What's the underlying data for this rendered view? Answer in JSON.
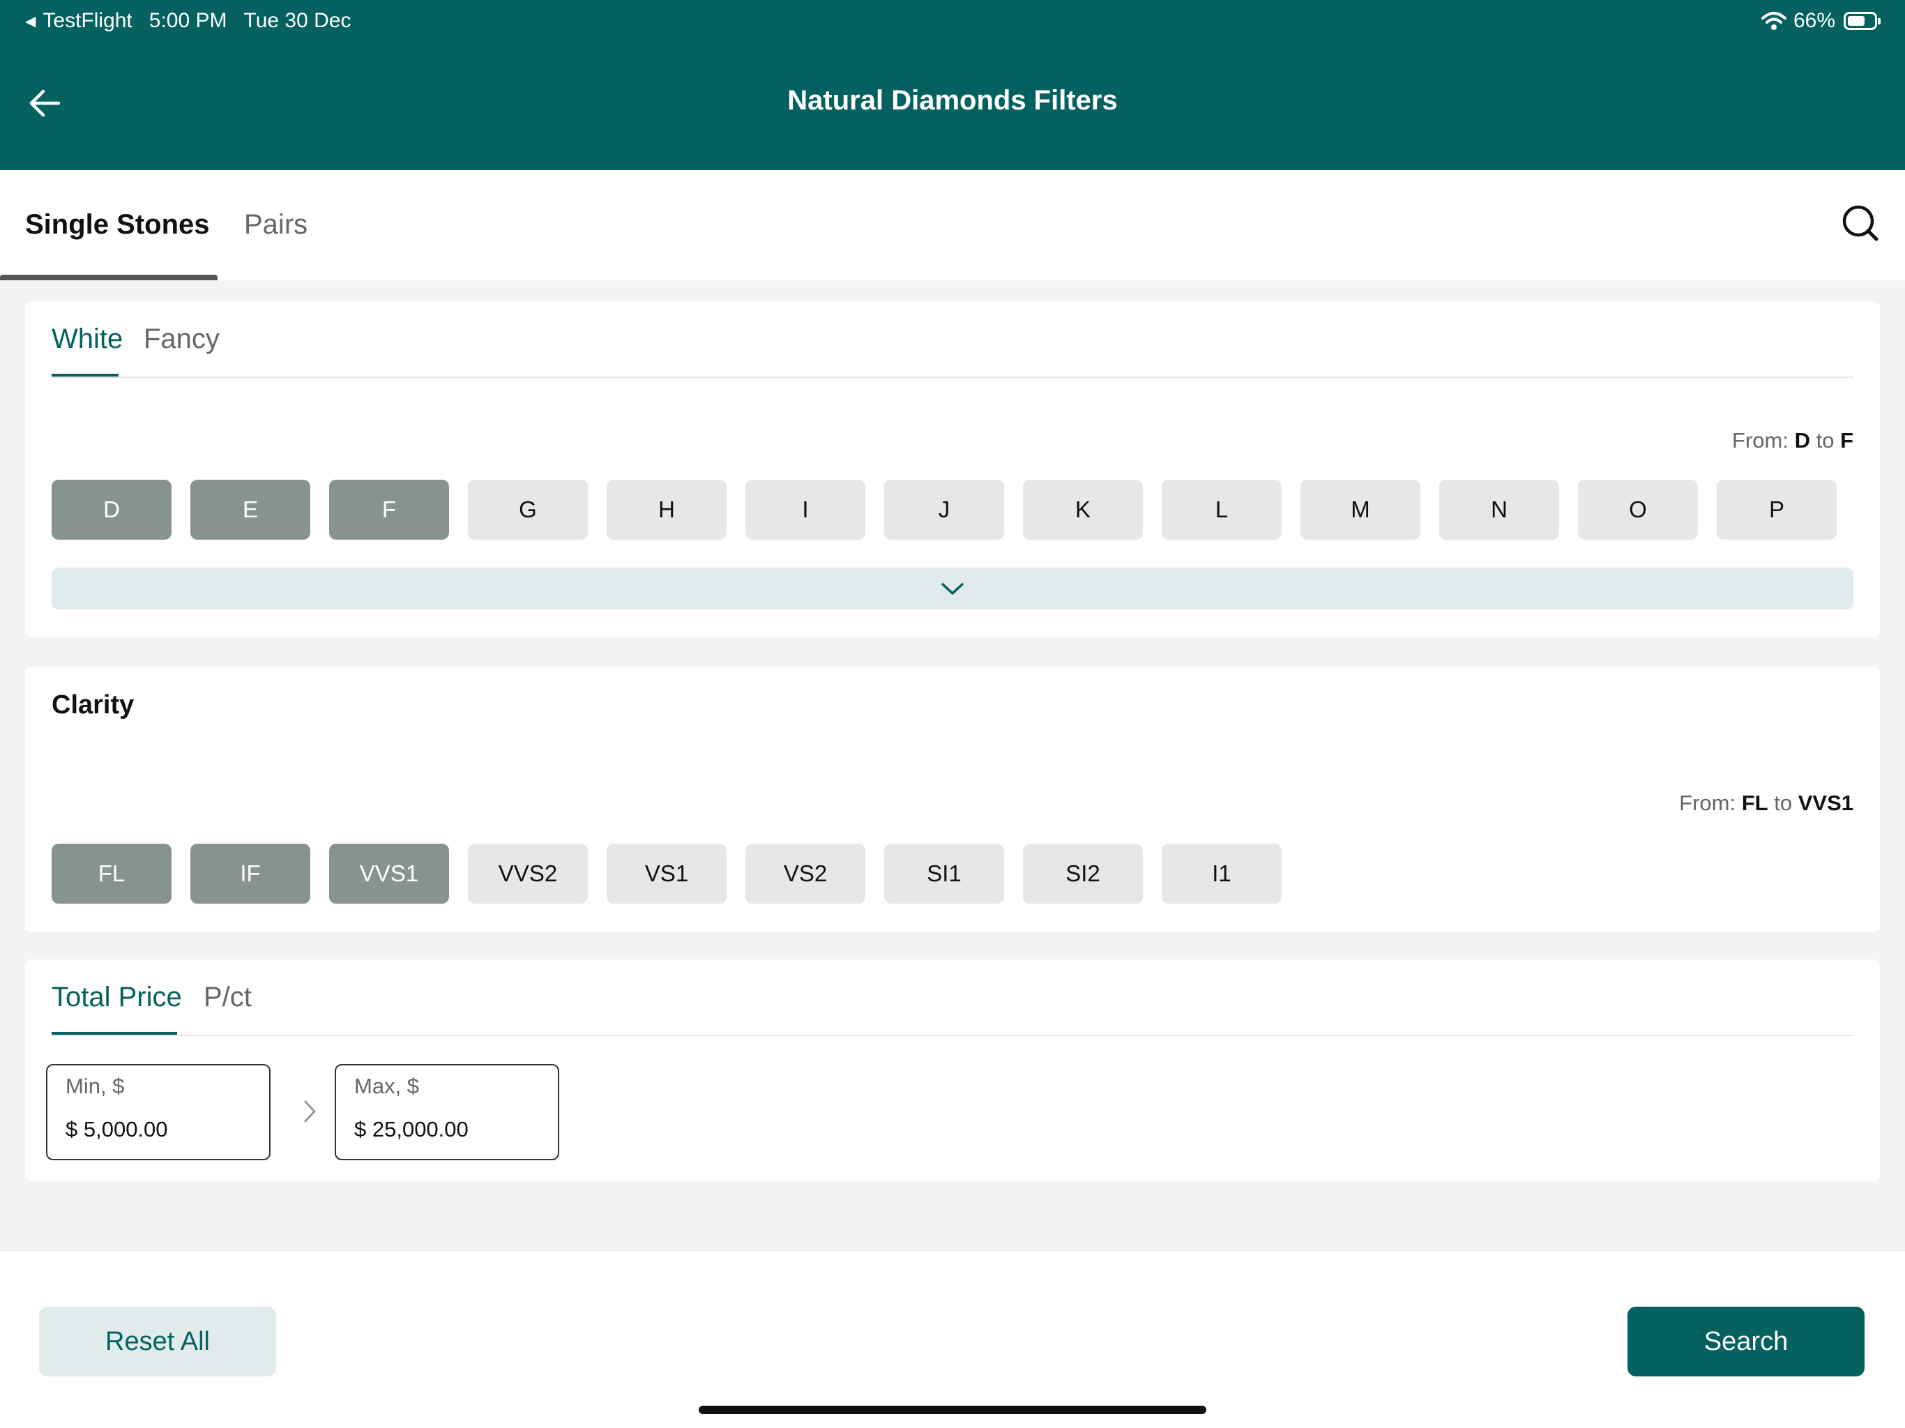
{
  "status_bar": {
    "back_app": "TestFlight",
    "time": "5:00 PM",
    "date": "Tue 30 Dec",
    "battery": "66%"
  },
  "header": {
    "title": "Natural Diamonds Filters"
  },
  "top_tabs": [
    {
      "label": "Single Stones",
      "active": true
    },
    {
      "label": "Pairs",
      "active": false
    }
  ],
  "color_section": {
    "tabs": [
      {
        "label": "White",
        "active": true
      },
      {
        "label": "Fancy",
        "active": false
      }
    ],
    "range": {
      "prefix": "From:",
      "from": "D",
      "joiner": "to",
      "to": "F"
    },
    "grades": [
      {
        "label": "D",
        "selected": true
      },
      {
        "label": "E",
        "selected": true
      },
      {
        "label": "F",
        "selected": true
      },
      {
        "label": "G",
        "selected": false
      },
      {
        "label": "H",
        "selected": false
      },
      {
        "label": "I",
        "selected": false
      },
      {
        "label": "J",
        "selected": false
      },
      {
        "label": "K",
        "selected": false
      },
      {
        "label": "L",
        "selected": false
      },
      {
        "label": "M",
        "selected": false
      },
      {
        "label": "N",
        "selected": false
      },
      {
        "label": "O",
        "selected": false
      },
      {
        "label": "P",
        "selected": false
      }
    ]
  },
  "clarity_section": {
    "title": "Clarity",
    "range": {
      "prefix": "From:",
      "from": "FL",
      "joiner": "to",
      "to": "VVS1"
    },
    "grades": [
      {
        "label": "FL",
        "selected": true
      },
      {
        "label": "IF",
        "selected": true
      },
      {
        "label": "VVS1",
        "selected": true
      },
      {
        "label": "VVS2",
        "selected": false
      },
      {
        "label": "VS1",
        "selected": false
      },
      {
        "label": "VS2",
        "selected": false
      },
      {
        "label": "SI1",
        "selected": false
      },
      {
        "label": "SI2",
        "selected": false
      },
      {
        "label": "I1",
        "selected": false
      }
    ]
  },
  "price_section": {
    "tabs": [
      {
        "label": "Total Price",
        "active": true
      },
      {
        "label": "P/ct",
        "active": false
      }
    ],
    "min": {
      "label": "Min, $",
      "value": "$ 5,000.00"
    },
    "max": {
      "label": "Max, $",
      "value": "$ 25,000.00"
    }
  },
  "footer": {
    "reset_label": "Reset All",
    "search_label": "Search"
  },
  "colors": {
    "brand": "#04615f",
    "chip_selected": "#879391",
    "chip_unselected": "#e7e7e7",
    "light_accent": "#e0ecec"
  },
  "icons": [
    "back-arrow-icon",
    "search-icon",
    "chevron-down-icon",
    "chevron-right-icon",
    "wifi-icon",
    "battery-icon"
  ]
}
